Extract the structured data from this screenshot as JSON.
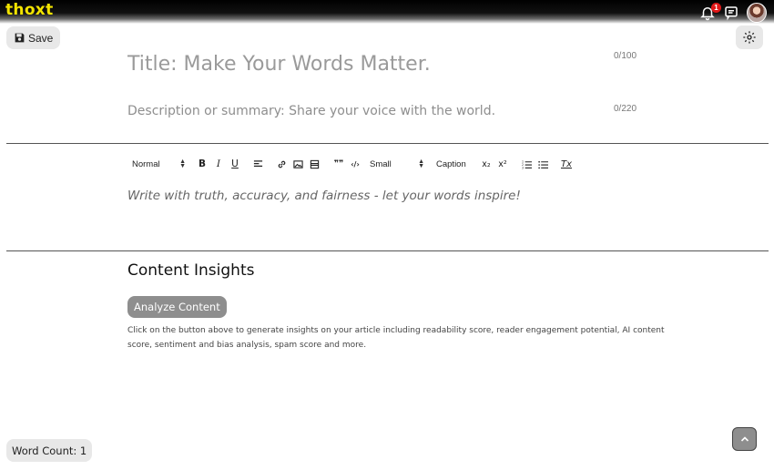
{
  "app": {
    "logo": "thoxt"
  },
  "header": {
    "notification_count": "1",
    "notification_icon": "bell-icon",
    "chat_icon": "chat-bubble-icon",
    "avatar_icon": "user-avatar"
  },
  "editor": {
    "save_label": "Save",
    "title_placeholder": "Title: Make Your Words Matter.",
    "title_count": "0/100",
    "description_placeholder": "Description or summary: Share your voice with the world.",
    "description_count": "0/220",
    "body_placeholder": "Write with truth, accuracy, and fairness - let your words inspire!"
  },
  "toolbar": {
    "heading_select": "Normal",
    "size_select": "Small",
    "caption_label": "Caption",
    "bold": "B",
    "italic": "I",
    "underline": "U",
    "blockquote": "❞❞",
    "code": "‹/›",
    "subscript": "x₂",
    "superscript": "x²",
    "clear_format": "Tx"
  },
  "insights": {
    "title": "Content Insights",
    "analyze_label": "Analyze Content",
    "description": "Click on the button above to generate insights on your article including readability score, reader engagement potential, AI content score, sentiment and bias analysis, spam score and more."
  },
  "footer": {
    "word_count_label": "Word Count: 1"
  },
  "colors": {
    "logo": "#f3e400",
    "badge": "#e01818",
    "button_gray": "#8e8e8e",
    "chip_gray": "#e8e8e8"
  }
}
